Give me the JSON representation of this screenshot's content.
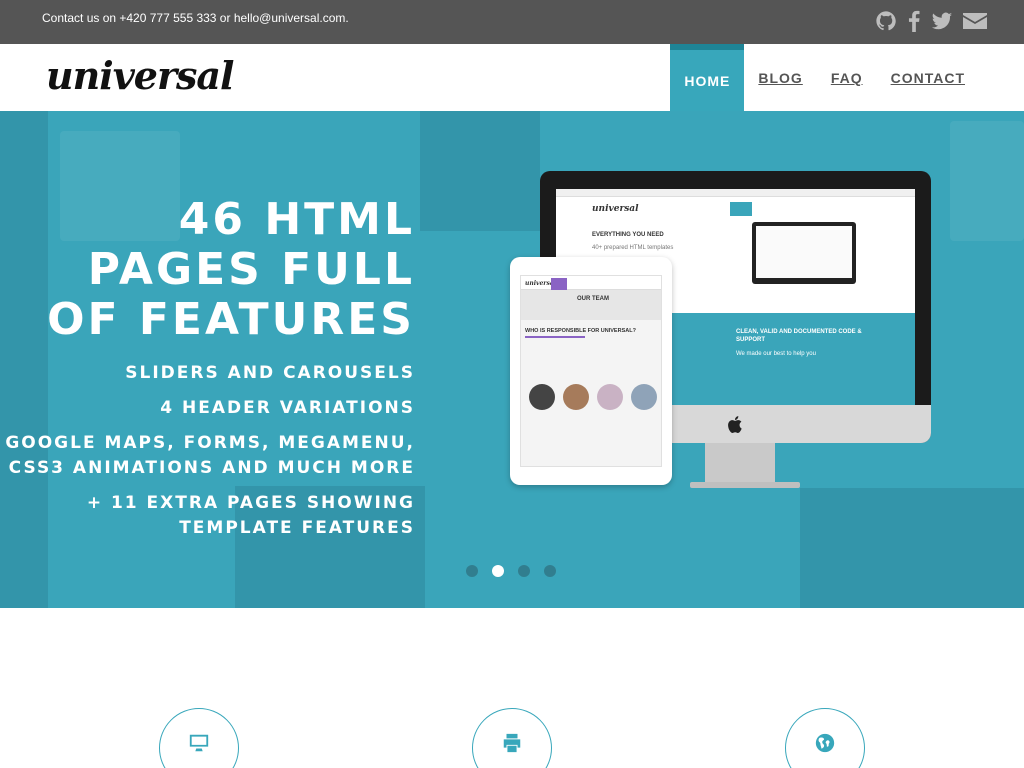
{
  "topbar": {
    "contact_text": "Contact us on +420 777 555 333 or hello@universal.com.",
    "social_icons": [
      "github-icon",
      "facebook-icon",
      "twitter-icon",
      "envelope-icon"
    ]
  },
  "header": {
    "logo_text": "universal",
    "nav": [
      {
        "label": "HOME",
        "active": true
      },
      {
        "label": "BLOG",
        "active": false
      },
      {
        "label": "FAQ",
        "active": false
      },
      {
        "label": "CONTACT",
        "active": false
      }
    ]
  },
  "hero": {
    "headline_lines": [
      "46 HTML",
      "PAGES FULL",
      "OF FEATURES"
    ],
    "features": [
      "SLIDERS AND CAROUSELS",
      "4 HEADER VARIATIONS",
      "GOOGLE MAPS, FORMS, MEGAMENU,",
      "CSS3 ANIMATIONS AND MUCH MORE",
      "+ 11 EXTRA PAGES SHOWING",
      "TEMPLATE FEATURES"
    ],
    "slide_count": 4,
    "active_slide": 2,
    "imac_screen": {
      "logo": "universal",
      "title": "EVERYTHING YOU NEED",
      "subtitle": "40+ prepared HTML templates",
      "panel_title": "CLEAN, VALID AND DOCUMENTED CODE & SUPPORT",
      "panel_text": "We made our best to help you"
    },
    "ipad_screen": {
      "logo": "universal",
      "banner": "OUR TEAM",
      "heading": "WHO IS RESPONSIBLE FOR UNIVERSAL?"
    }
  },
  "services": [
    {
      "icon": "desktop-icon"
    },
    {
      "icon": "print-icon"
    },
    {
      "icon": "globe-icon"
    }
  ],
  "colors": {
    "accent": "#38a7bb",
    "topbar": "#555555",
    "hero": "#3aa5ba"
  }
}
